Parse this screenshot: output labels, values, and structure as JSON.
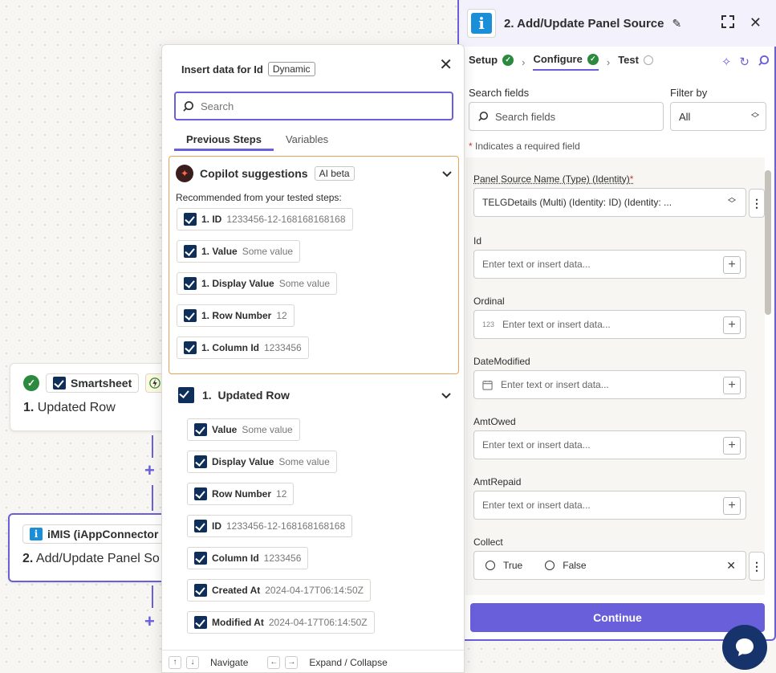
{
  "canvas": {
    "node1": {
      "app": "Smartsheet",
      "title_num": "1.",
      "title": "Updated Row"
    },
    "node2": {
      "app": "iMIS (iAppConnector",
      "title_num": "2.",
      "title": "Add/Update Panel So"
    }
  },
  "insert_panel": {
    "title": "Insert data for Id",
    "badge": "Dynamic",
    "search_placeholder": "Search",
    "tabs": [
      "Previous Steps",
      "Variables"
    ],
    "copilot": {
      "title": "Copilot suggestions",
      "badge": "AI beta",
      "subtitle": "Recommended from your tested steps:",
      "items": [
        {
          "label": "1. ID",
          "value": "1233456-12-168168168168"
        },
        {
          "label": "1. Value",
          "value": "Some value"
        },
        {
          "label": "1. Display Value",
          "value": "Some value"
        },
        {
          "label": "1. Row Number",
          "value": "12"
        },
        {
          "label": "1. Column Id",
          "value": "1233456"
        }
      ]
    },
    "step": {
      "num": "1.",
      "title": "Updated Row",
      "items": [
        {
          "label": "Value",
          "value": "Some value"
        },
        {
          "label": "Display Value",
          "value": "Some value"
        },
        {
          "label": "Row Number",
          "value": "12"
        },
        {
          "label": "ID",
          "value": "1233456-12-168168168168"
        },
        {
          "label": "Column Id",
          "value": "1233456"
        },
        {
          "label": "Created At",
          "value": "2024-04-17T06:14:50Z"
        },
        {
          "label": "Modified At",
          "value": "2024-04-17T06:14:50Z"
        }
      ]
    },
    "footer": {
      "navigate": "Navigate",
      "expand": "Expand / Collapse"
    }
  },
  "editor": {
    "title": "2. Add/Update Panel Source",
    "steps": {
      "setup": "Setup",
      "configure": "Configure",
      "test": "Test"
    },
    "search_label": "Search fields",
    "search_placeholder": "Search fields",
    "filter_label": "Filter by",
    "filter_value": "All",
    "required_note": "Indicates a required field",
    "fields": {
      "panel_source": {
        "label": "Panel Source Name (Type) (Identity)",
        "value": "TELGDetails (Multi) (Identity: ID) (Identity: ..."
      },
      "id": {
        "label": "Id",
        "placeholder": "Enter text or insert data..."
      },
      "ordinal": {
        "label": "Ordinal",
        "prefix": "123",
        "placeholder": "Enter text or insert data..."
      },
      "datemodified": {
        "label": "DateModified",
        "placeholder": "Enter text or insert data..."
      },
      "amtowed": {
        "label": "AmtOwed",
        "placeholder": "Enter text or insert data..."
      },
      "amtrepaid": {
        "label": "AmtRepaid",
        "placeholder": "Enter text or insert data..."
      },
      "collect": {
        "label": "Collect",
        "opt_true": "True",
        "opt_false": "False"
      }
    },
    "continue_label": "Continue"
  }
}
